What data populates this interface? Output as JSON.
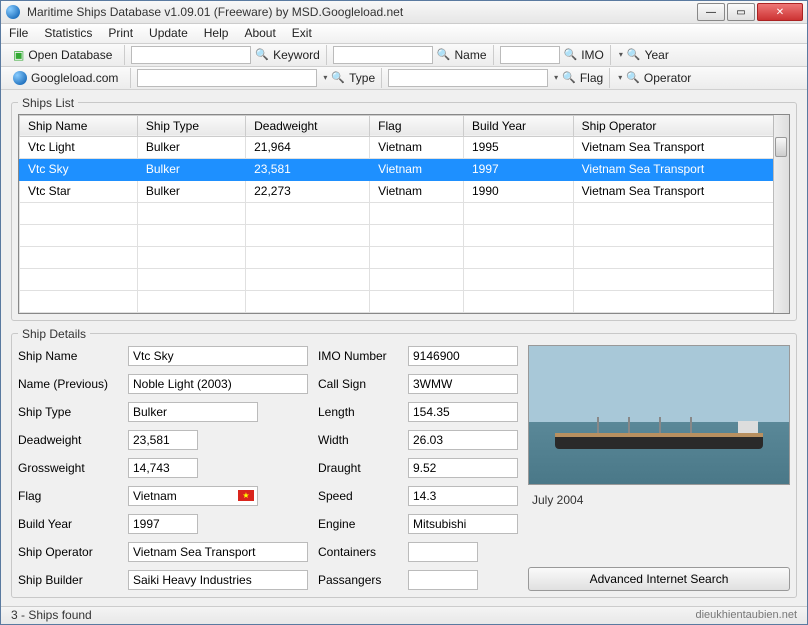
{
  "title": "Maritime Ships Database v1.09.01 (Freeware) by MSD.Googleload.net",
  "menu": [
    "File",
    "Statistics",
    "Print",
    "Update",
    "Help",
    "About",
    "Exit"
  ],
  "toolbar1": {
    "open": "Open Database",
    "keyword": "Keyword",
    "name": "Name",
    "imo": "IMO",
    "year": "Year"
  },
  "toolbar2": {
    "site": "Googleload.com",
    "type": "Type",
    "flag": "Flag",
    "operator": "Operator"
  },
  "list": {
    "legend": "Ships List",
    "headers": [
      "Ship Name",
      "Ship Type",
      "Deadweight",
      "Flag",
      "Build Year",
      "Ship Operator"
    ],
    "rows": [
      {
        "name": "Vtc Light",
        "type": "Bulker",
        "dwt": "21,964",
        "flag": "Vietnam",
        "year": "1995",
        "op": "Vietnam Sea Transport",
        "sel": false
      },
      {
        "name": "Vtc Sky",
        "type": "Bulker",
        "dwt": "23,581",
        "flag": "Vietnam",
        "year": "1997",
        "op": "Vietnam Sea Transport",
        "sel": true
      },
      {
        "name": "Vtc Star",
        "type": "Bulker",
        "dwt": "22,273",
        "flag": "Vietnam",
        "year": "1990",
        "op": "Vietnam Sea Transport",
        "sel": false
      }
    ]
  },
  "details": {
    "legend": "Ship Details",
    "labels": {
      "shipName": "Ship Name",
      "prevName": "Name (Previous)",
      "shipType": "Ship Type",
      "dwt": "Deadweight",
      "gwt": "Grossweight",
      "flag": "Flag",
      "year": "Build Year",
      "operator": "Ship Operator",
      "builder": "Ship Builder",
      "imo": "IMO Number",
      "callsign": "Call Sign",
      "length": "Length",
      "width": "Width",
      "draught": "Draught",
      "speed": "Speed",
      "engine": "Engine",
      "containers": "Containers",
      "passengers": "Passangers"
    },
    "values": {
      "shipName": "Vtc Sky",
      "prevName": "Noble Light (2003)",
      "shipType": "Bulker",
      "dwt": "23,581",
      "gwt": "14,743",
      "flag": "Vietnam",
      "year": "1997",
      "operator": "Vietnam Sea Transport",
      "builder": "Saiki Heavy Industries",
      "imo": "9146900",
      "callsign": "3WMW",
      "length": "154.35",
      "width": "26.03",
      "draught": "9.52",
      "speed": "14.3",
      "engine": "Mitsubishi",
      "containers": "",
      "passengers": ""
    },
    "photoCaption": "July 2004",
    "advBtn": "Advanced Internet Search"
  },
  "status": {
    "left": "3 - Ships found",
    "right": "dieukhientaubien.net"
  }
}
